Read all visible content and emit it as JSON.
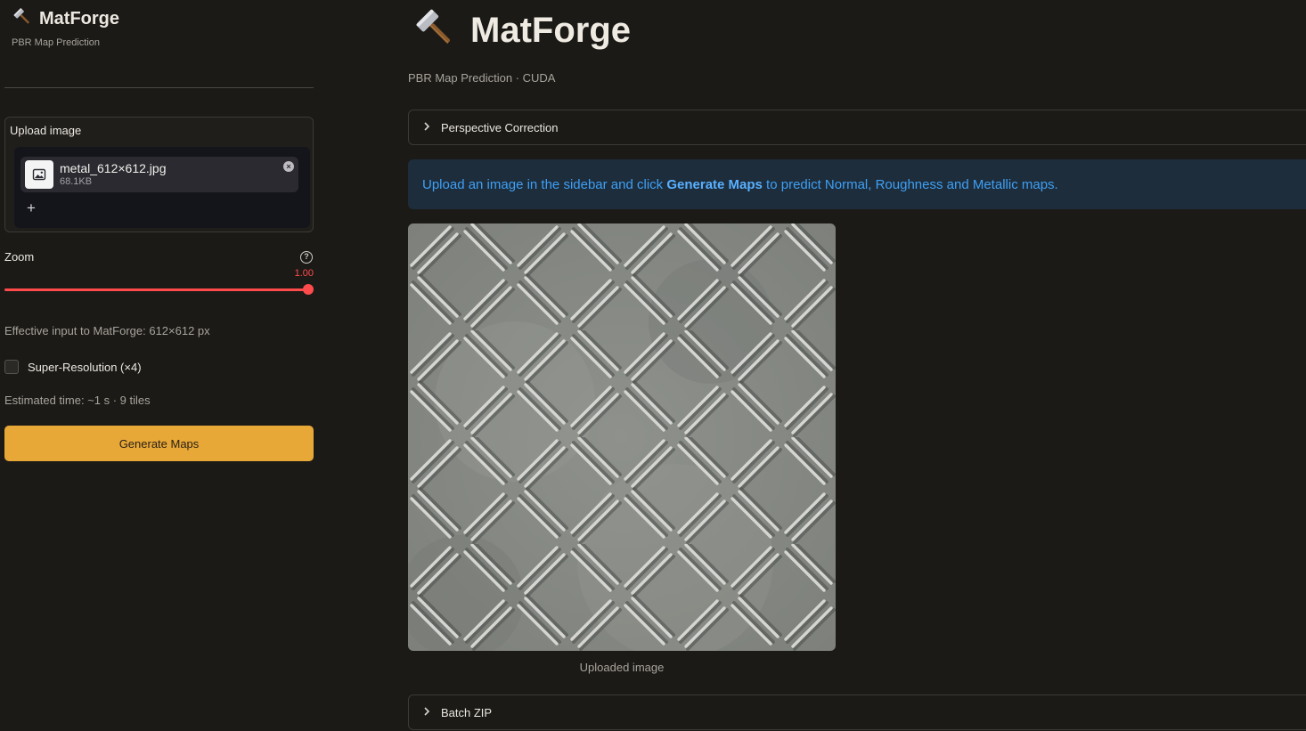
{
  "sidebar": {
    "brand_title": "MatForge",
    "brand_subtitle": "PBR Map Prediction",
    "upload_label": "Upload image",
    "file": {
      "name": "metal_612×612.jpg",
      "size": "68.1KB"
    },
    "add_symbol": "+",
    "zoom_label": "Zoom",
    "zoom_value": "1.00",
    "zoom_fraction": 1.0,
    "effective_input": "Effective input to MatForge: 612×612 px",
    "super_resolution_label": "Super-Resolution (×4)",
    "super_resolution_checked": false,
    "estimated_time": "Estimated time: ~1 s · 9 tiles",
    "generate_button": "Generate Maps"
  },
  "main": {
    "title": "MatForge",
    "subtitle": "PBR Map Prediction · CUDA",
    "perspective_expander": "Perspective Correction",
    "info": {
      "prefix": "Upload an image in the sidebar and click ",
      "bold": "Generate Maps",
      "suffix": " to predict Normal, Roughness and Metallic maps."
    },
    "image_caption": "Uploaded image",
    "batch_expander": "Batch ZIP"
  },
  "icons": {
    "brand": "hammer-icon",
    "file": "image-file-icon",
    "remove": "close-circle-icon",
    "help": "question-circle-icon",
    "expander": "chevron-right-icon"
  },
  "colors": {
    "accent": "#ff4b4b",
    "primary_button": "#e8a838",
    "info_background": "#1e2d3c",
    "info_text": "#3ea0f5",
    "background": "#1b1a17"
  }
}
